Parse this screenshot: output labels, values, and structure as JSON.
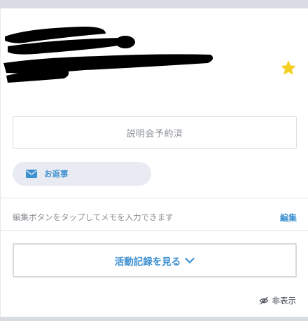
{
  "card": {
    "status_text": "説明会予約済",
    "reply": {
      "label": "お返事",
      "icon": "mail-icon"
    },
    "memo": {
      "hint": "編集ボタンをタップしてメモを入力できます",
      "edit_label": "編集"
    },
    "activity_button_label": "活動記録を見る",
    "hide_label": "非表示",
    "favorite_icon": "star-icon"
  },
  "colors": {
    "accent": "#3e91d1",
    "star": "#f5cf24",
    "muted_text": "#8a8e94",
    "chip_bg": "#e9ebf3",
    "border": "#d6d9de"
  }
}
